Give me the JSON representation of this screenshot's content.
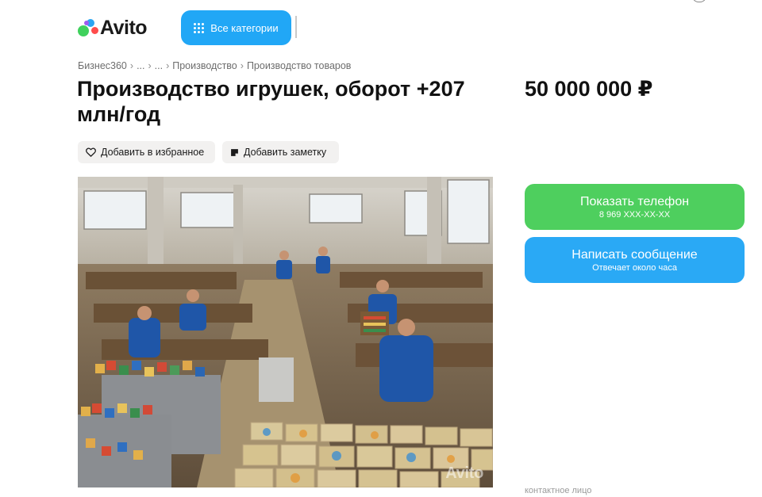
{
  "header": {
    "logo_text": "Avito",
    "categories_label": "Все категории"
  },
  "breadcrumb": {
    "items": [
      "Бизнес360",
      "...",
      "...",
      "Производство",
      "Производство товаров"
    ],
    "separator": "›"
  },
  "listing": {
    "title": "Производство игрушек, оборот +207 млн/год",
    "price": "50 000 000 ₽",
    "favorite_label": "Добавить в избранное",
    "note_label": "Добавить заметку",
    "photo_watermark": "Avito"
  },
  "contact": {
    "phone_label": "Показать телефон",
    "phone_masked": "8 969 XXX-XX-XX",
    "message_label": "Написать сообщение",
    "message_sub": "Отвечает около часа",
    "partial_text": "контактное лицо"
  },
  "colors": {
    "accent_blue": "#21a7f6",
    "accent_green": "#4ecf5e",
    "pill_bg": "#f2f1f0"
  }
}
